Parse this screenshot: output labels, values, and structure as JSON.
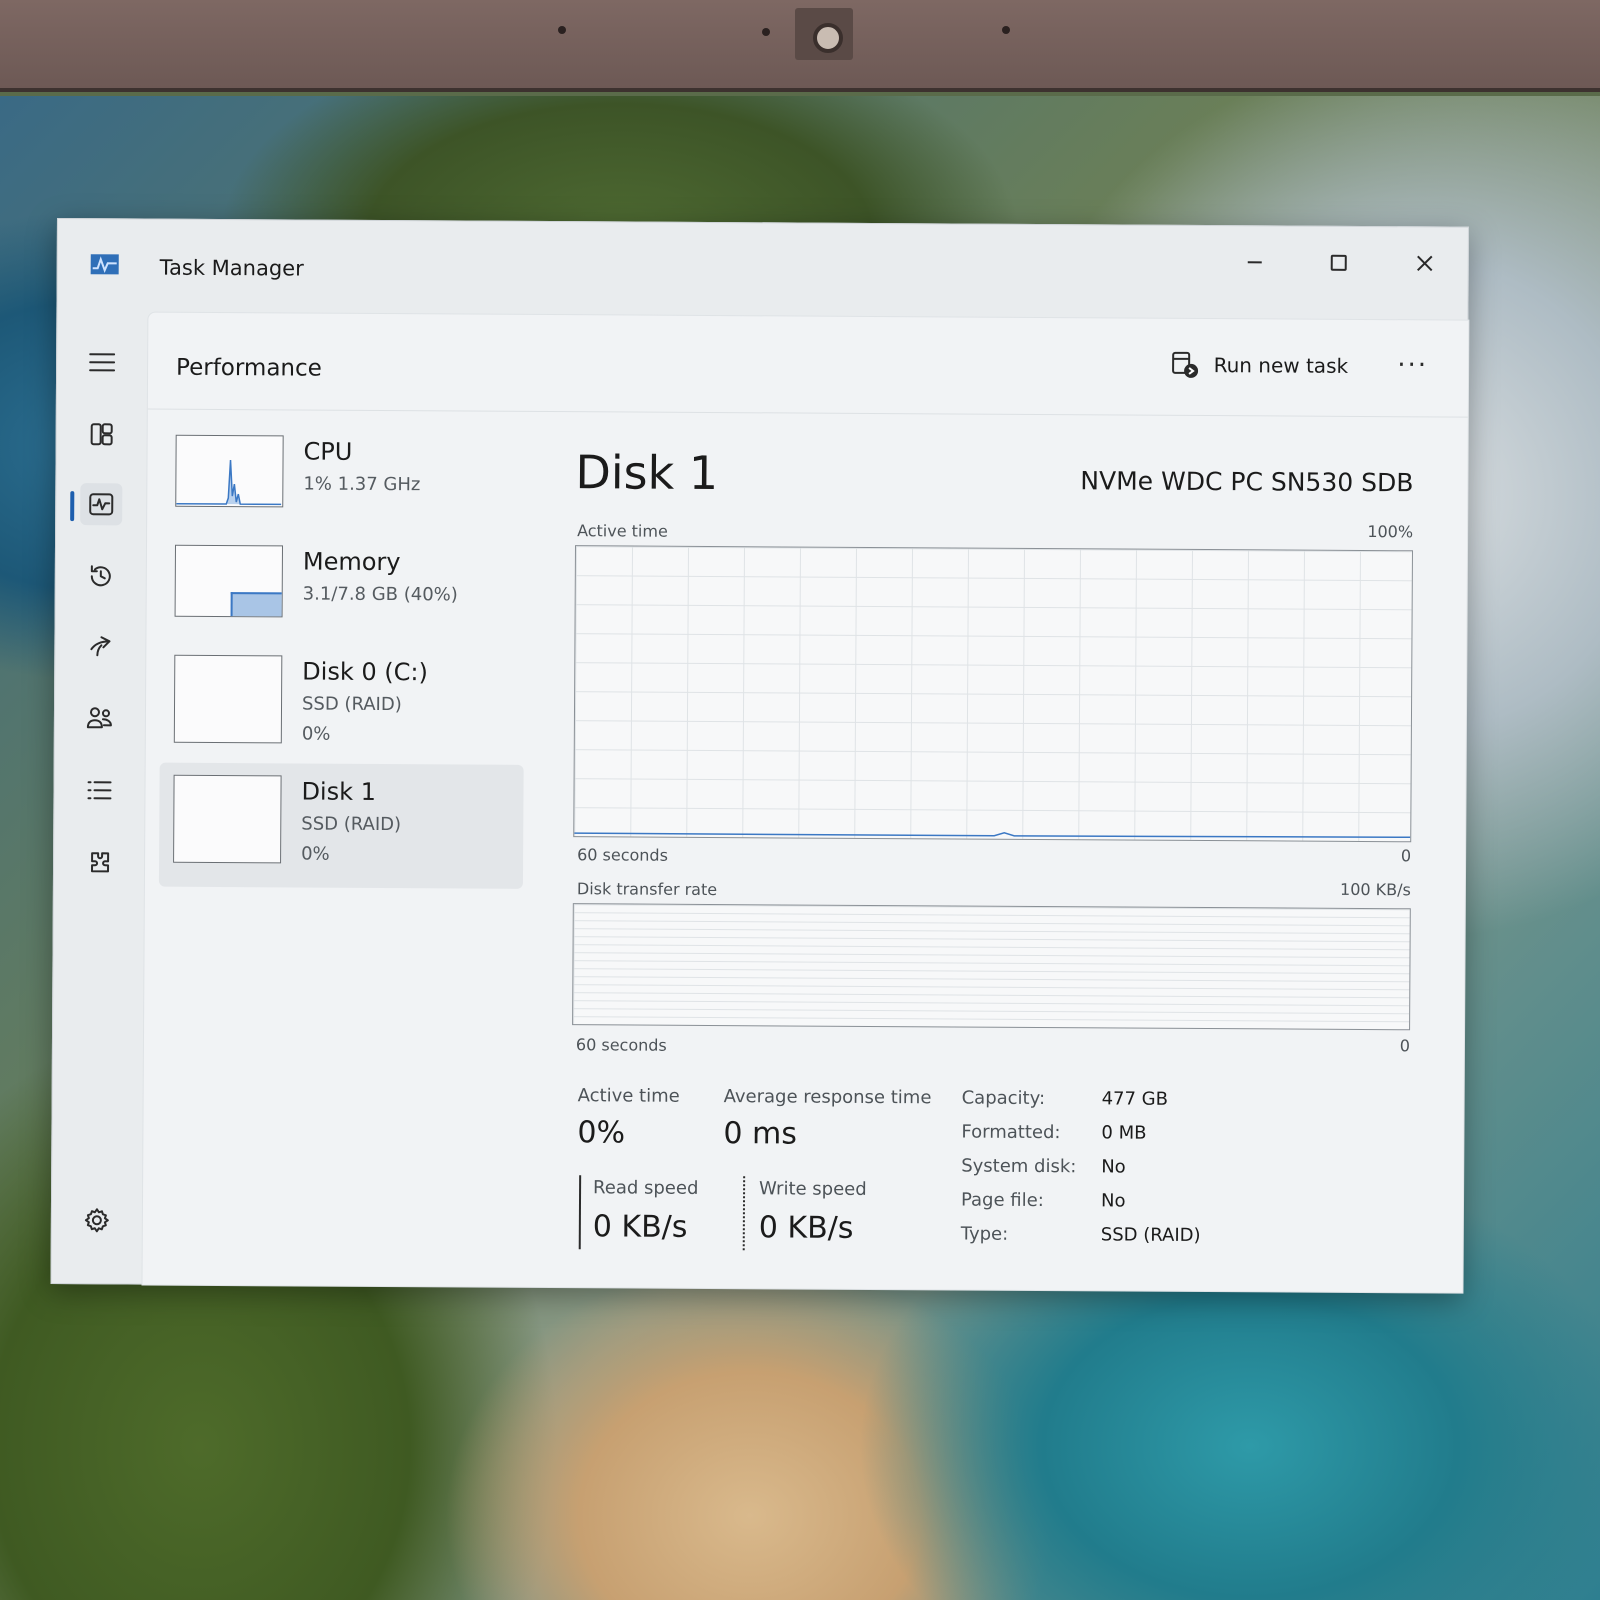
{
  "window": {
    "title": "Task Manager"
  },
  "header": {
    "page_title": "Performance",
    "run_new_task_label": "Run new task",
    "more_label": "···"
  },
  "devices": [
    {
      "name": "CPU",
      "sub": "1% 1.37 GHz",
      "sub2": ""
    },
    {
      "name": "Memory",
      "sub": "3.1/7.8 GB (40%)",
      "sub2": "",
      "usage_fraction": 0.4
    },
    {
      "name": "Disk 0 (C:)",
      "sub": "SSD (RAID)",
      "sub2": "0%"
    },
    {
      "name": "Disk 1",
      "sub": "SSD (RAID)",
      "sub2": "0%",
      "selected": true
    }
  ],
  "detail": {
    "title": "Disk 1",
    "model": "NVMe WDC PC SN530 SDB",
    "graph1": {
      "label": "Active time",
      "max": "100%",
      "span": "60 seconds",
      "min": "0"
    },
    "graph2": {
      "label": "Disk transfer rate",
      "max": "100 KB/s",
      "span": "60 seconds",
      "min": "0"
    }
  },
  "stats": {
    "active_time_label": "Active time",
    "active_time_value": "0%",
    "avg_response_label": "Average response time",
    "avg_response_value": "0 ms",
    "read_speed_label": "Read speed",
    "read_speed_value": "0 KB/s",
    "write_speed_label": "Write speed",
    "write_speed_value": "0 KB/s",
    "properties": [
      {
        "key": "Capacity:",
        "value": "477 GB"
      },
      {
        "key": "Formatted:",
        "value": "0 MB"
      },
      {
        "key": "System disk:",
        "value": "No"
      },
      {
        "key": "Page file:",
        "value": "No"
      },
      {
        "key": "Type:",
        "value": "SSD (RAID)"
      }
    ]
  },
  "colors": {
    "accent": "#1e5fae",
    "memory_fill": "#a9c5e6"
  }
}
